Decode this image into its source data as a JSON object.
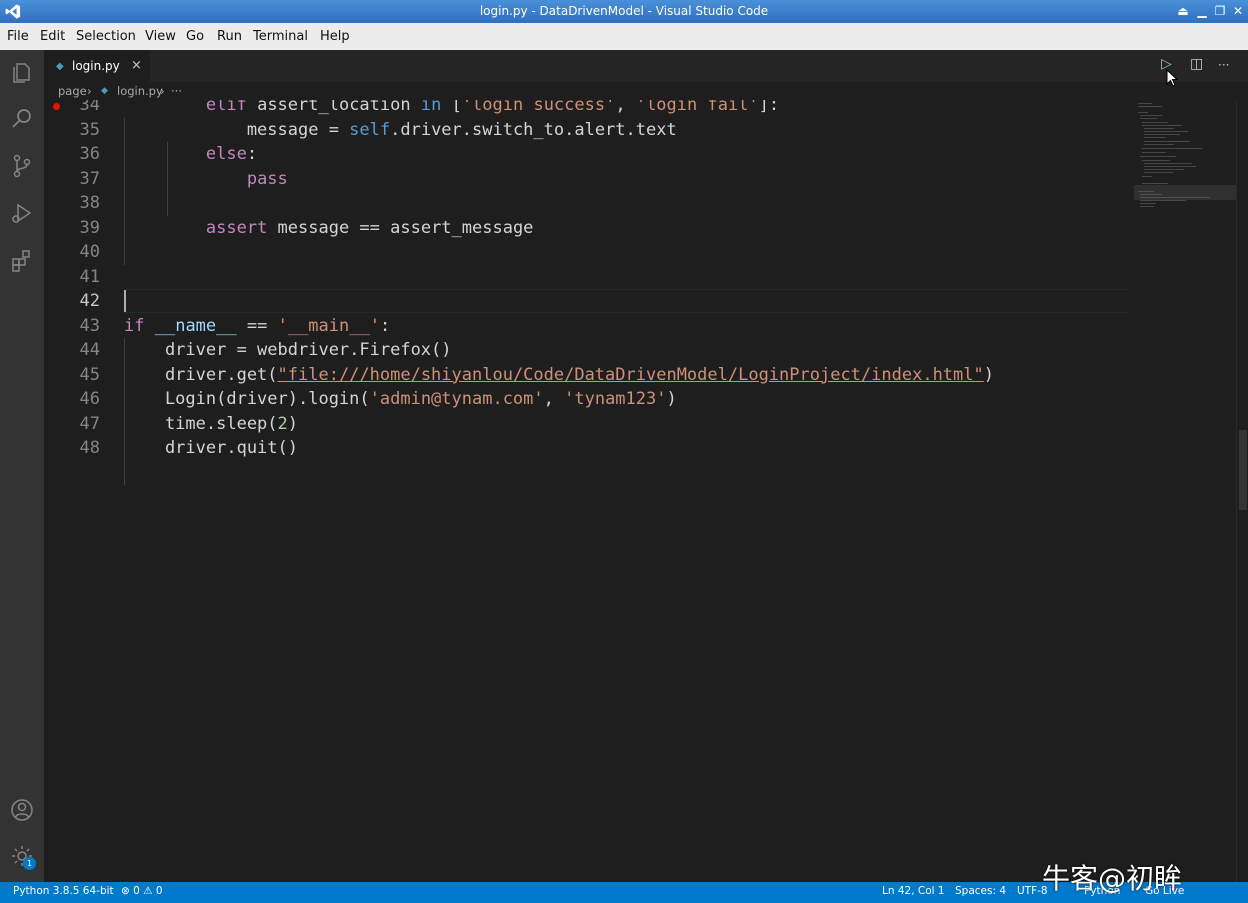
{
  "window": {
    "title": "login.py - DataDrivenModel - Visual Studio Code"
  },
  "menu": [
    "File",
    "Edit",
    "Selection",
    "View",
    "Go",
    "Run",
    "Terminal",
    "Help"
  ],
  "tab": {
    "label": "login.py",
    "close": "×"
  },
  "breadcrumb": {
    "folder": "page",
    "sep1": "›",
    "file": "login.py",
    "sep2": "›",
    "more": "···"
  },
  "editor_actions": {
    "run": "▷",
    "split": "◫",
    "more": "···"
  },
  "code_lines": [
    {
      "n": "34",
      "tokens": [
        [
          "plain",
          "        "
        ],
        [
          "kw",
          "elif"
        ],
        [
          "plain",
          " assert_location "
        ],
        [
          "bi",
          "in"
        ],
        [
          "plain",
          " ["
        ],
        [
          "str",
          "'login success'"
        ],
        [
          "plain",
          ", "
        ],
        [
          "str",
          "'login fail'"
        ],
        [
          "plain",
          "]:"
        ]
      ]
    },
    {
      "n": "35",
      "tokens": [
        [
          "plain",
          "            message = "
        ],
        [
          "bi",
          "self"
        ],
        [
          "plain",
          ".driver.switch_to.alert.text"
        ]
      ]
    },
    {
      "n": "36",
      "tokens": [
        [
          "plain",
          "        "
        ],
        [
          "kw",
          "else"
        ],
        [
          "plain",
          ":"
        ]
      ]
    },
    {
      "n": "37",
      "tokens": [
        [
          "plain",
          "            "
        ],
        [
          "kw",
          "pass"
        ]
      ]
    },
    {
      "n": "38",
      "tokens": []
    },
    {
      "n": "39",
      "tokens": [
        [
          "plain",
          "        "
        ],
        [
          "kw",
          "assert"
        ],
        [
          "plain",
          " message == assert_message"
        ]
      ]
    },
    {
      "n": "40",
      "tokens": []
    },
    {
      "n": "41",
      "tokens": []
    },
    {
      "n": "42",
      "tokens": []
    },
    {
      "n": "43",
      "tokens": [
        [
          "kw",
          "if"
        ],
        [
          "plain",
          " "
        ],
        [
          "var",
          "__name__"
        ],
        [
          "plain",
          " == "
        ],
        [
          "str",
          "'__main__'"
        ],
        [
          "plain",
          ":"
        ]
      ]
    },
    {
      "n": "44",
      "tokens": [
        [
          "plain",
          "    driver = webdriver.Firefox()"
        ]
      ]
    },
    {
      "n": "45",
      "tokens": [
        [
          "plain",
          "    driver.get("
        ],
        [
          "url",
          "\"file:///home/shiyanlou/Code/DataDrivenModel/LoginProject/index.html\""
        ],
        [
          "plain",
          ")"
        ]
      ]
    },
    {
      "n": "46",
      "tokens": [
        [
          "plain",
          "    Login(driver).login("
        ],
        [
          "str",
          "'admin@tynam.com'"
        ],
        [
          "plain",
          ", "
        ],
        [
          "str",
          "'tynam123'"
        ],
        [
          "plain",
          ")"
        ]
      ]
    },
    {
      "n": "47",
      "tokens": [
        [
          "plain",
          "    time.sleep("
        ],
        [
          "num",
          "2"
        ],
        [
          "plain",
          ")"
        ]
      ]
    },
    {
      "n": "48",
      "tokens": [
        [
          "plain",
          "    driver.quit()"
        ]
      ]
    }
  ],
  "active_line": "42",
  "status": {
    "interpreter": "Python 3.8.5 64-bit",
    "problems": "⊗ 0 ⚠ 0",
    "position": "Ln 42, Col 1",
    "spaces": "Spaces: 4",
    "encoding": "UTF-8",
    "language": "Python",
    "golive": "Go Live"
  },
  "watermark": "牛客@初眸",
  "accounts_badge": "1",
  "colors": {
    "accent": "#007acc",
    "keyword": "#c586c0",
    "string": "#ce9178",
    "builtin": "#569cd6"
  },
  "icons": [
    "vscode-logo-icon",
    "explorer-icon",
    "search-icon",
    "source-control-icon",
    "run-debug-icon",
    "extensions-icon",
    "accounts-icon",
    "manage-gear-icon"
  ]
}
